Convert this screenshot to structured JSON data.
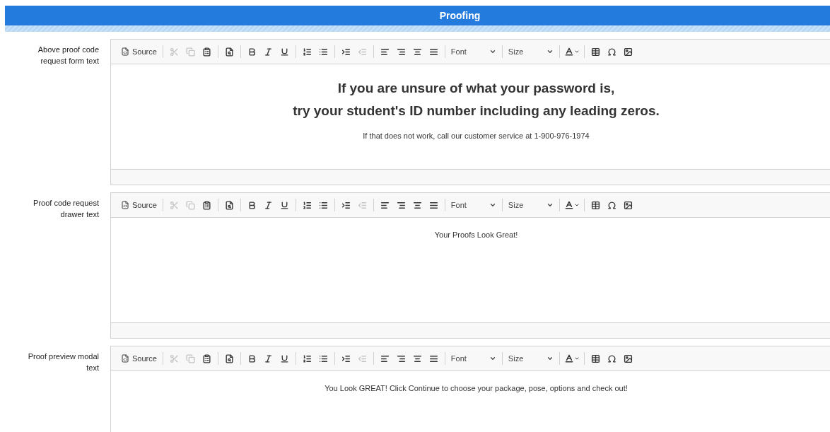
{
  "header": {
    "title": "Proofing"
  },
  "editors": [
    {
      "label": "Above proof code request form text",
      "statusbar": true,
      "toolbar": [
        {
          "kind": "source",
          "label": "Source",
          "disabled": false
        },
        {
          "kind": "sep"
        },
        {
          "kind": "cut",
          "disabled": true
        },
        {
          "kind": "copy",
          "disabled": true
        },
        {
          "kind": "paste",
          "disabled": false
        },
        {
          "kind": "sep"
        },
        {
          "kind": "preview",
          "disabled": false
        },
        {
          "kind": "sep"
        },
        {
          "kind": "bold",
          "disabled": false
        },
        {
          "kind": "italic",
          "disabled": false
        },
        {
          "kind": "underline",
          "disabled": false
        },
        {
          "kind": "sep"
        },
        {
          "kind": "ol",
          "disabled": false
        },
        {
          "kind": "ul",
          "disabled": false
        },
        {
          "kind": "sep"
        },
        {
          "kind": "indent",
          "disabled": false
        },
        {
          "kind": "outdent",
          "disabled": true
        },
        {
          "kind": "sep"
        },
        {
          "kind": "left",
          "disabled": false
        },
        {
          "kind": "right",
          "disabled": false
        },
        {
          "kind": "center",
          "disabled": false
        },
        {
          "kind": "justify",
          "disabled": false
        },
        {
          "kind": "sep"
        },
        {
          "kind": "dropdown",
          "label": "Font"
        },
        {
          "kind": "sep"
        },
        {
          "kind": "dropdown",
          "label": "Size"
        },
        {
          "kind": "sep"
        },
        {
          "kind": "color",
          "disabled": false
        },
        {
          "kind": "sep"
        },
        {
          "kind": "table",
          "disabled": false
        },
        {
          "kind": "omega",
          "disabled": false
        },
        {
          "kind": "image",
          "disabled": false
        }
      ],
      "content": [
        {
          "kind": "heading",
          "text": "If you are unsure of what your password is,"
        },
        {
          "kind": "heading",
          "text": "try your student's ID number including any leading zeros."
        },
        {
          "kind": "normal",
          "text": "If that does not work, call our customer service at 1-900-976-1974"
        }
      ]
    },
    {
      "label": "Proof code request drawer text",
      "statusbar": true,
      "toolbar": [
        {
          "kind": "source",
          "label": "Source",
          "disabled": false
        },
        {
          "kind": "sep"
        },
        {
          "kind": "cut",
          "disabled": true
        },
        {
          "kind": "copy",
          "disabled": true
        },
        {
          "kind": "paste",
          "disabled": false
        },
        {
          "kind": "sep"
        },
        {
          "kind": "preview",
          "disabled": false
        },
        {
          "kind": "sep"
        },
        {
          "kind": "bold",
          "disabled": false
        },
        {
          "kind": "italic",
          "disabled": false
        },
        {
          "kind": "underline",
          "disabled": false
        },
        {
          "kind": "sep"
        },
        {
          "kind": "ol",
          "disabled": false
        },
        {
          "kind": "ul",
          "disabled": false
        },
        {
          "kind": "sep"
        },
        {
          "kind": "indent",
          "disabled": false
        },
        {
          "kind": "outdent",
          "disabled": true
        },
        {
          "kind": "sep"
        },
        {
          "kind": "left",
          "disabled": false
        },
        {
          "kind": "right",
          "disabled": false
        },
        {
          "kind": "center",
          "disabled": false
        },
        {
          "kind": "justify",
          "disabled": false
        },
        {
          "kind": "sep"
        },
        {
          "kind": "dropdown",
          "label": "Font"
        },
        {
          "kind": "sep"
        },
        {
          "kind": "dropdown",
          "label": "Size"
        },
        {
          "kind": "sep"
        },
        {
          "kind": "color",
          "disabled": false
        },
        {
          "kind": "sep"
        },
        {
          "kind": "table",
          "disabled": false
        },
        {
          "kind": "omega",
          "disabled": false
        },
        {
          "kind": "image",
          "disabled": false
        }
      ],
      "content": [
        {
          "kind": "normal",
          "text": "Your Proofs Look Great!"
        }
      ]
    },
    {
      "label": "Proof preview modal text",
      "statusbar": false,
      "toolbar": [
        {
          "kind": "source",
          "label": "Source",
          "disabled": false
        },
        {
          "kind": "sep"
        },
        {
          "kind": "cut",
          "disabled": true
        },
        {
          "kind": "copy",
          "disabled": true
        },
        {
          "kind": "paste",
          "disabled": false
        },
        {
          "kind": "sep"
        },
        {
          "kind": "preview",
          "disabled": false
        },
        {
          "kind": "sep"
        },
        {
          "kind": "bold",
          "disabled": false
        },
        {
          "kind": "italic",
          "disabled": false
        },
        {
          "kind": "underline",
          "disabled": false
        },
        {
          "kind": "sep"
        },
        {
          "kind": "ol",
          "disabled": false
        },
        {
          "kind": "ul",
          "disabled": false
        },
        {
          "kind": "sep"
        },
        {
          "kind": "indent",
          "disabled": false
        },
        {
          "kind": "outdent",
          "disabled": true
        },
        {
          "kind": "sep"
        },
        {
          "kind": "left",
          "disabled": false
        },
        {
          "kind": "right",
          "disabled": false
        },
        {
          "kind": "center",
          "disabled": false
        },
        {
          "kind": "justify",
          "disabled": false
        },
        {
          "kind": "sep"
        },
        {
          "kind": "dropdown",
          "label": "Font"
        },
        {
          "kind": "sep"
        },
        {
          "kind": "dropdown",
          "label": "Size"
        },
        {
          "kind": "sep"
        },
        {
          "kind": "color",
          "disabled": false
        },
        {
          "kind": "sep"
        },
        {
          "kind": "table",
          "disabled": false
        },
        {
          "kind": "omega",
          "disabled": false
        },
        {
          "kind": "image",
          "disabled": false
        }
      ],
      "content": [
        {
          "kind": "normal",
          "text": "You Look GREAT! Click Continue to choose your package, pose, options and check out!"
        }
      ]
    }
  ]
}
